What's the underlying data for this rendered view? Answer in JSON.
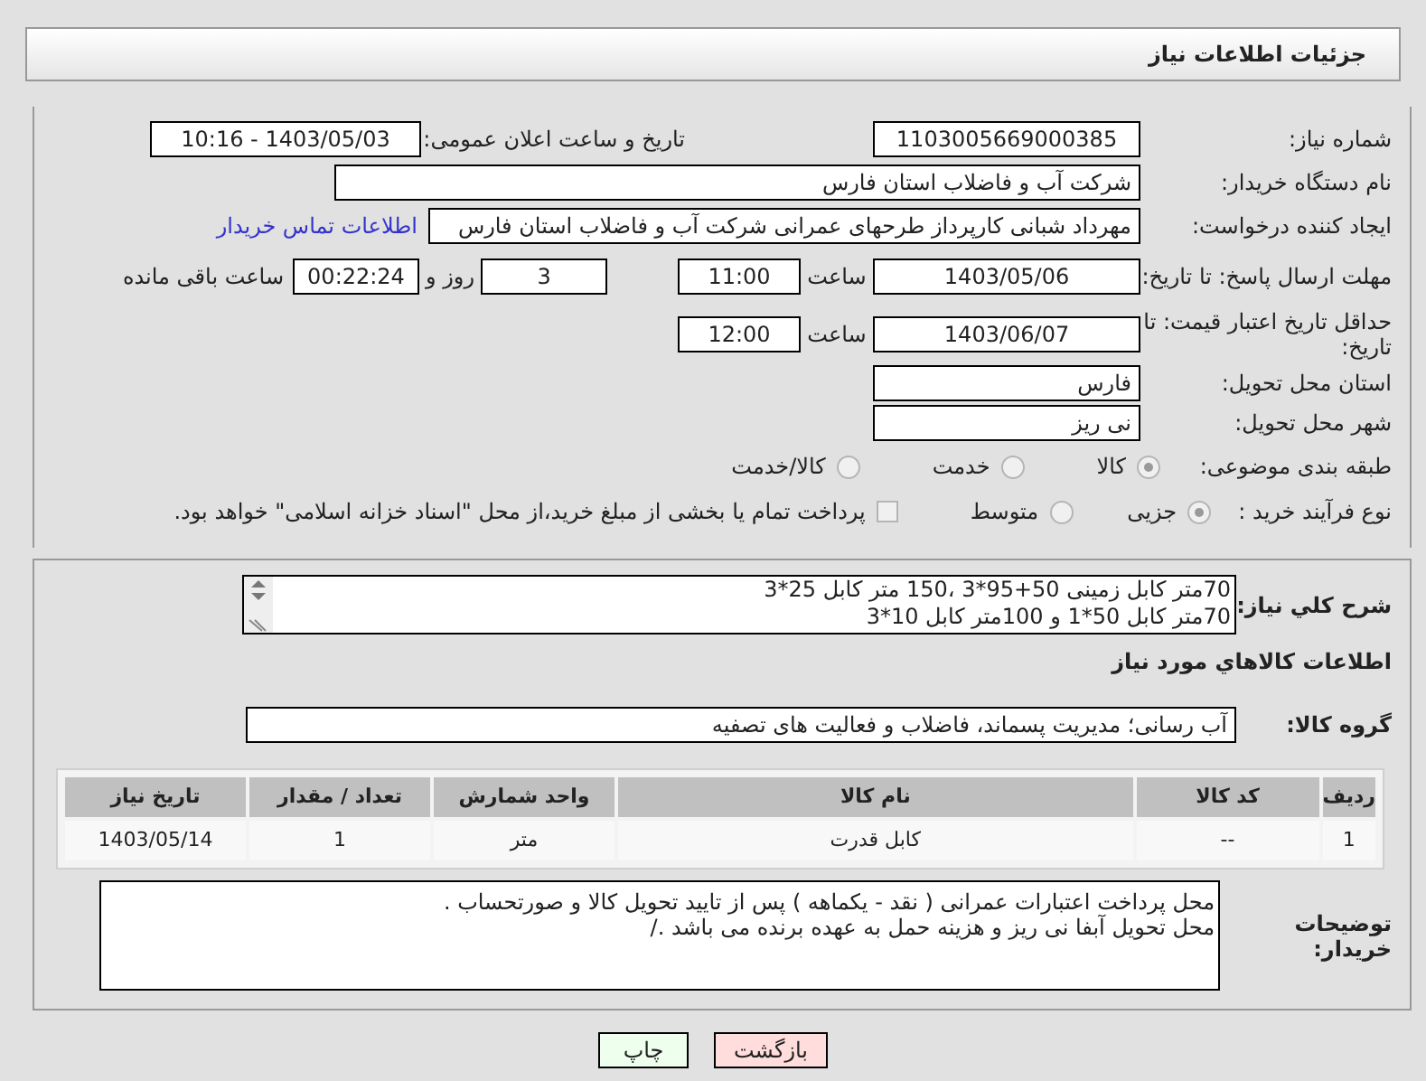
{
  "header": {
    "title": "جزئیات اطلاعات نیاز"
  },
  "need_number": {
    "label": "شماره نیاز:",
    "value": "1103005669000385"
  },
  "announce": {
    "label": "تاریخ و ساعت اعلان عمومی:",
    "value": "1403/05/03 - 10:16"
  },
  "buyer": {
    "label": "نام دستگاه خریدار:",
    "value": "شرکت آب و فاضلاب استان فارس"
  },
  "creator": {
    "label": "ایجاد کننده درخواست:",
    "value": "مهرداد شبانی کارپرداز طرحهای عمرانی  شرکت آب و فاضلاب استان فارس",
    "link": "اطلاعات تماس خریدار"
  },
  "deadline": {
    "label": "مهلت ارسال پاسخ: تا تاریخ:",
    "date": "1403/05/06",
    "time_label": "ساعت",
    "time": "11:00",
    "days": "3",
    "days_label": "روز و",
    "remaining": "00:22:24",
    "remaining_label": "ساعت باقی مانده"
  },
  "validity": {
    "label": "حداقل تاریخ اعتبار قیمت: تا تاریخ:",
    "date": "1403/06/07",
    "time_label": "ساعت",
    "time": "12:00"
  },
  "province": {
    "label": "استان محل تحویل:",
    "value": "فارس"
  },
  "city": {
    "label": "شهر محل تحویل:",
    "value": "نی ریز"
  },
  "category": {
    "label": "طبقه بندی موضوعی:",
    "options": [
      {
        "label": "کالا",
        "selected": true
      },
      {
        "label": "خدمت",
        "selected": false
      },
      {
        "label": "کالا/خدمت",
        "selected": false
      }
    ]
  },
  "process": {
    "label": "نوع فرآیند خرید :",
    "options": [
      {
        "label": "جزیی",
        "selected": true
      },
      {
        "label": "متوسط",
        "selected": false
      }
    ],
    "payment": {
      "label": "پرداخت تمام یا بخشی از مبلغ خرید،از محل \"اسناد خزانه اسلامی\" خواهد بود.",
      "checked": false
    }
  },
  "description": {
    "label": "شرح کلي نیاز:",
    "lines": [
      "70متر کابل زمینی 50+95*3 ،150 متر کابل 25*3",
      "70متر کابل  50*1 و 100متر کابل 10*3"
    ]
  },
  "goods_heading": "اطلاعات کالاهاي مورد نیاز",
  "group": {
    "label": "گروه کالا:",
    "value": "آب رسانی؛ مدیریت پسماند، فاضلاب و فعالیت های تصفیه"
  },
  "table": {
    "columns": [
      "ردیف",
      "کد کالا",
      "نام کالا",
      "واحد شمارش",
      "تعداد / مقدار",
      "تاریخ نیاز"
    ],
    "rows": [
      [
        "1",
        "--",
        "کابل قدرت",
        "متر",
        "1",
        "1403/05/14"
      ]
    ]
  },
  "notes": {
    "label": "توضیحات خریدار:",
    "lines": [
      "محل پرداخت اعتبارات عمرانی  ( نقد -  یکماهه  ) پس از تایید تحویل کالا و صورتحساب .",
      "محل تحویل آبفا  نی ریز و هزینه حمل به عهده برنده می باشد ./"
    ]
  },
  "buttons": [
    {
      "label": "بازگشت",
      "kind": "back"
    },
    {
      "label": "چاپ",
      "kind": "print"
    }
  ]
}
